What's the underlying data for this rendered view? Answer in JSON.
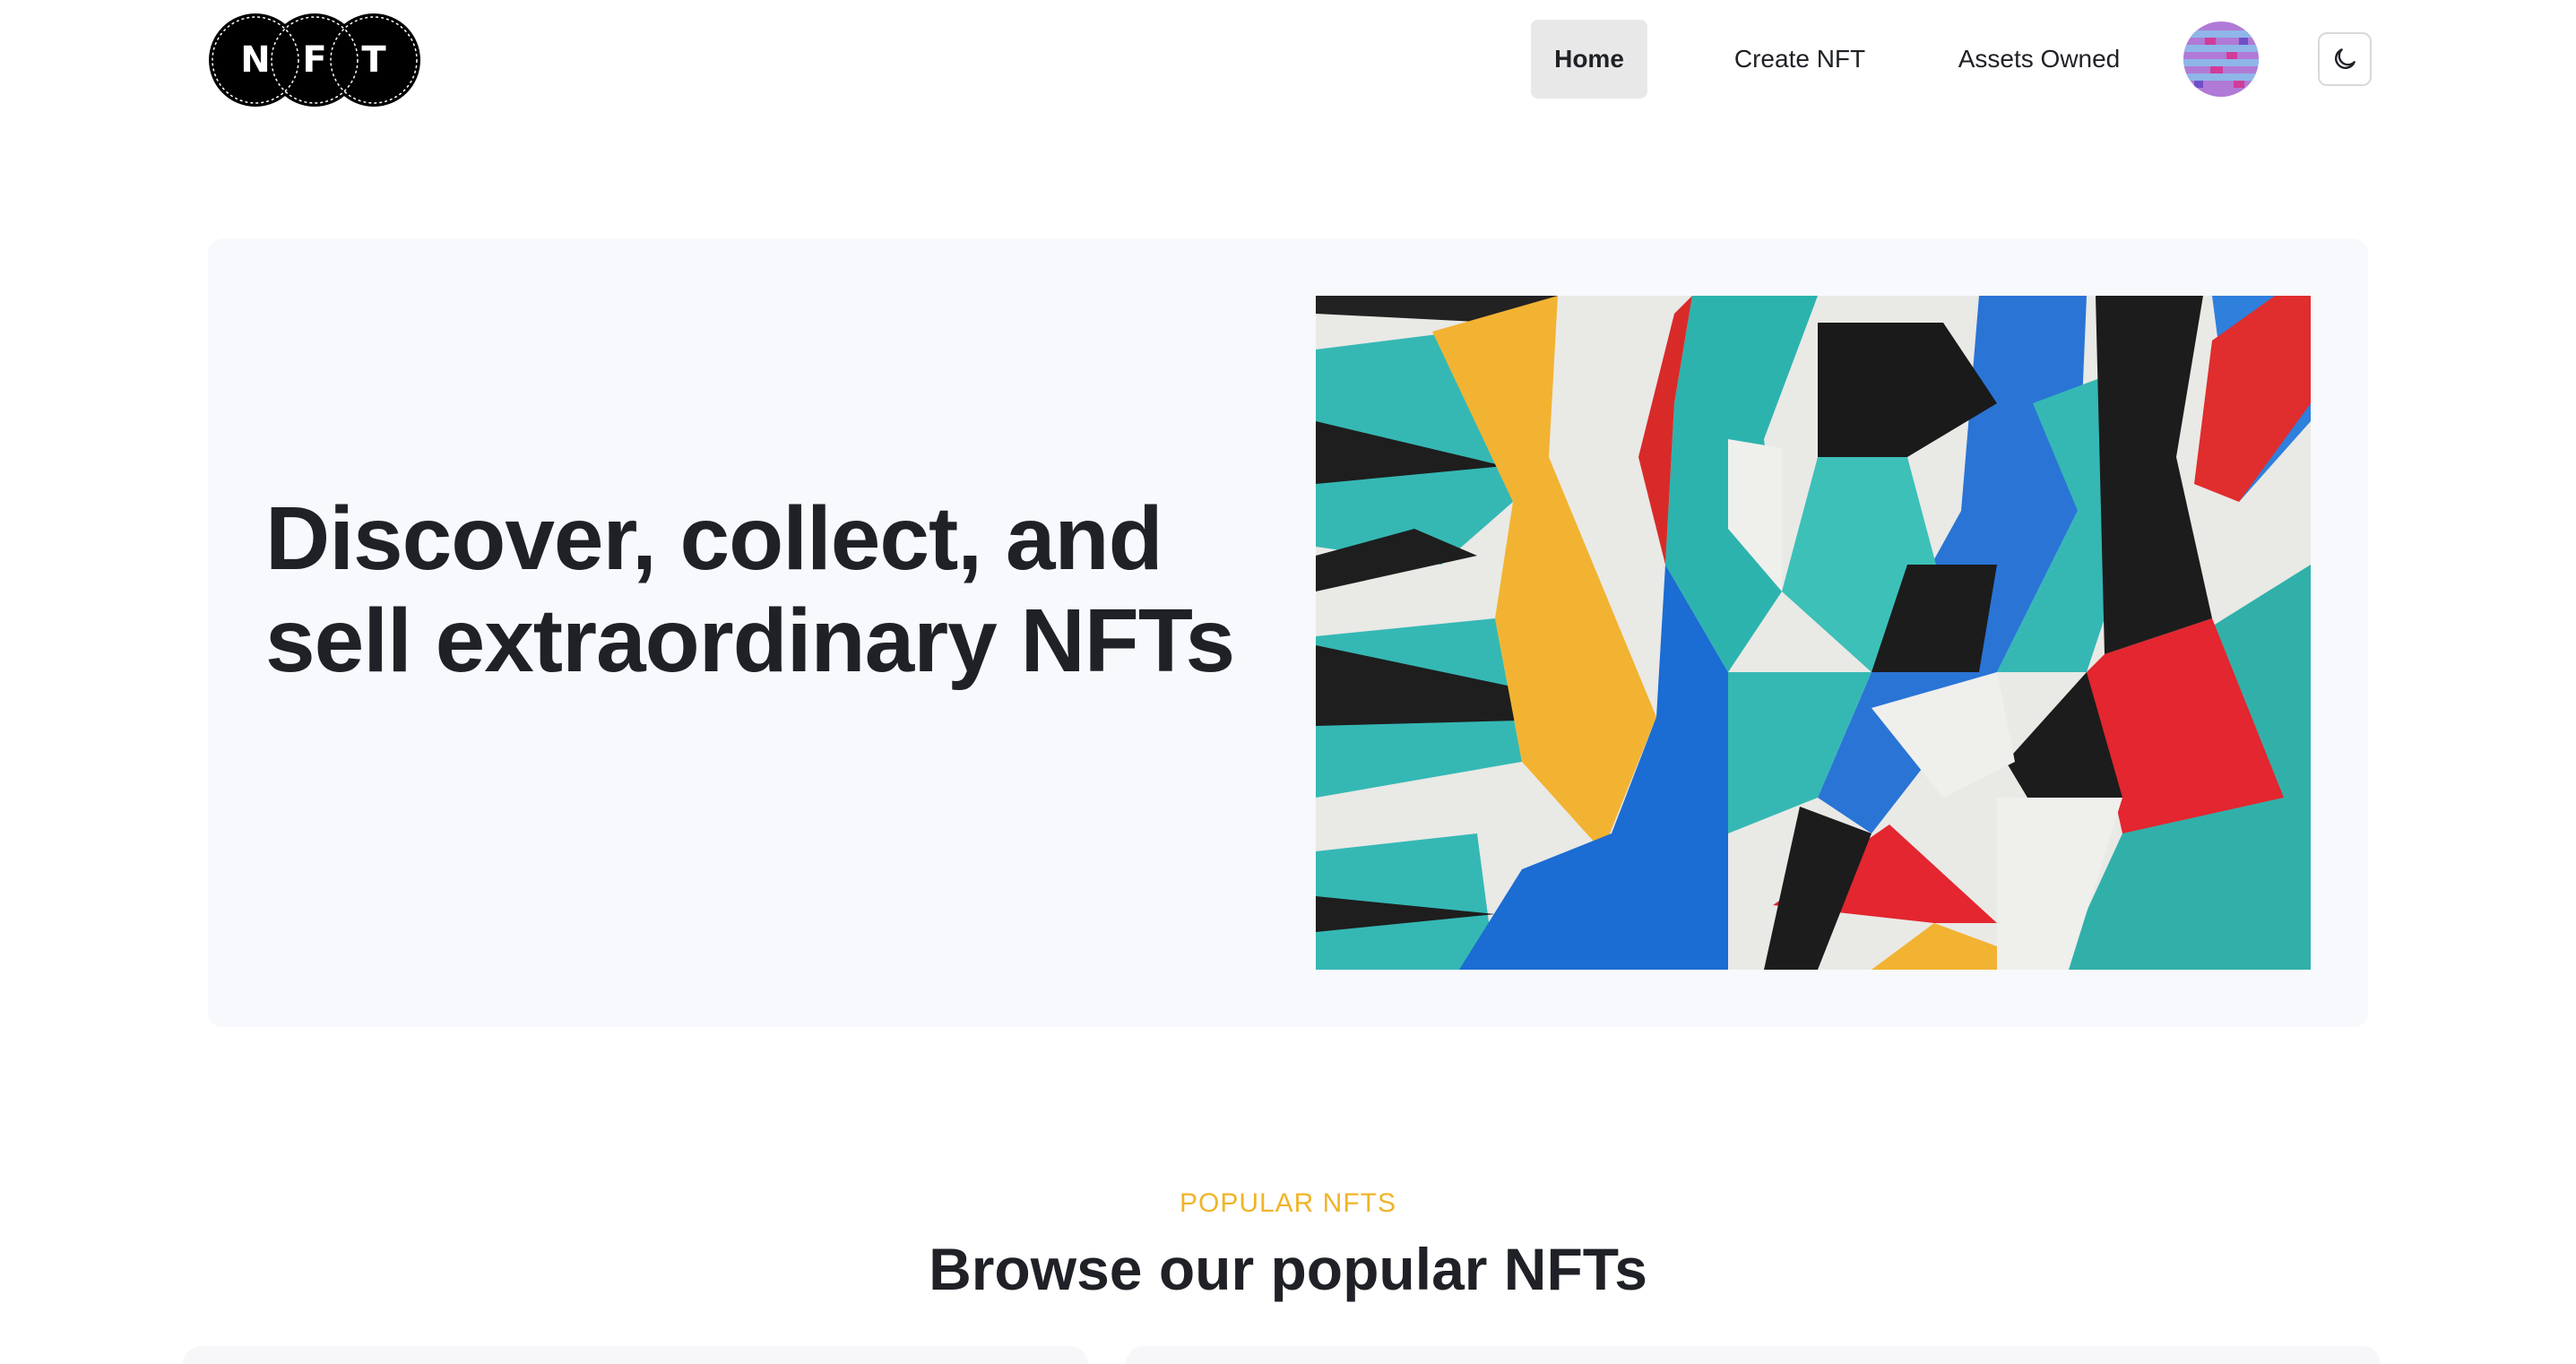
{
  "header": {
    "logo_letters": [
      "N",
      "F",
      "T"
    ],
    "nav": {
      "home": "Home",
      "create": "Create NFT",
      "assets": "Assets Owned"
    },
    "theme_toggle_icon": "moon-icon",
    "avatar_icon": "avatar"
  },
  "hero": {
    "title": "Discover, collect, and sell extraordinary NFTs"
  },
  "popular": {
    "kicker": "POPULAR NFTS",
    "title": "Browse our popular NFTs"
  },
  "colors": {
    "accent": "#f0b429",
    "nav_active_bg": "#e8e8e8",
    "hero_bg": "#f8f9fc",
    "text": "#1f2126"
  }
}
